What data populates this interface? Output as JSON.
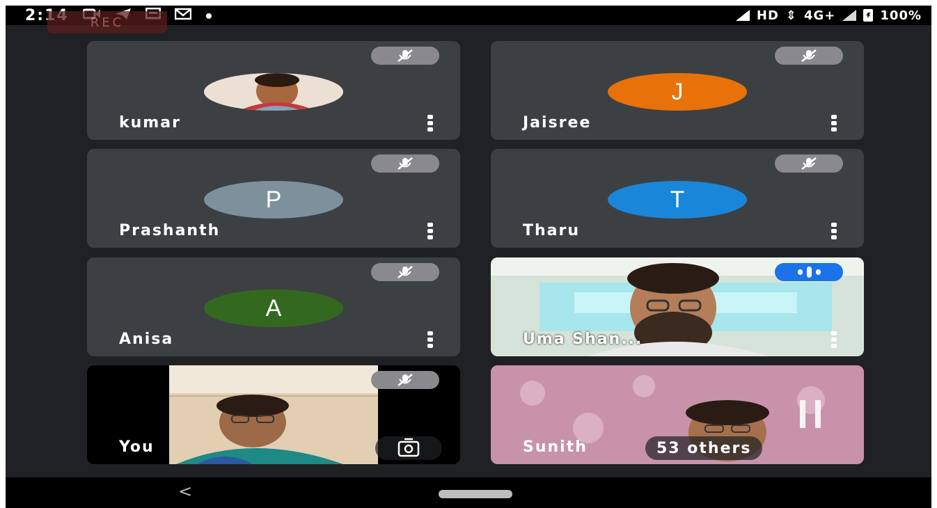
{
  "status_bar": {
    "time": "2:14",
    "rec_label": "REC",
    "network": "HD",
    "network_type": "4G+",
    "battery": "100%"
  },
  "participants": [
    {
      "name": "kumar",
      "type": "photo",
      "muted": true
    },
    {
      "name": "Jaisree",
      "initial": "J",
      "avatar_color": "#e8710a",
      "muted": true
    },
    {
      "name": "Prashanth",
      "initial": "P",
      "avatar_color": "#7c919c",
      "muted": true
    },
    {
      "name": "Tharu",
      "initial": "T",
      "avatar_color": "#1a86d9",
      "muted": true
    },
    {
      "name": "Anisa",
      "initial": "A",
      "avatar_color": "#33691e",
      "muted": true
    },
    {
      "name": "Uma Shan...",
      "type": "video",
      "speaking": true
    },
    {
      "name": "You",
      "type": "video",
      "muted": true
    },
    {
      "name": "Sunith",
      "type": "video",
      "others_label": "53 others"
    }
  ],
  "nav": {
    "back_glyph": "<"
  },
  "icons": {
    "mic_off": "mic-off-icon",
    "more": "more-vert-icon",
    "speaking": "audio-level-icon",
    "camera_switch": "switch-camera-icon"
  }
}
